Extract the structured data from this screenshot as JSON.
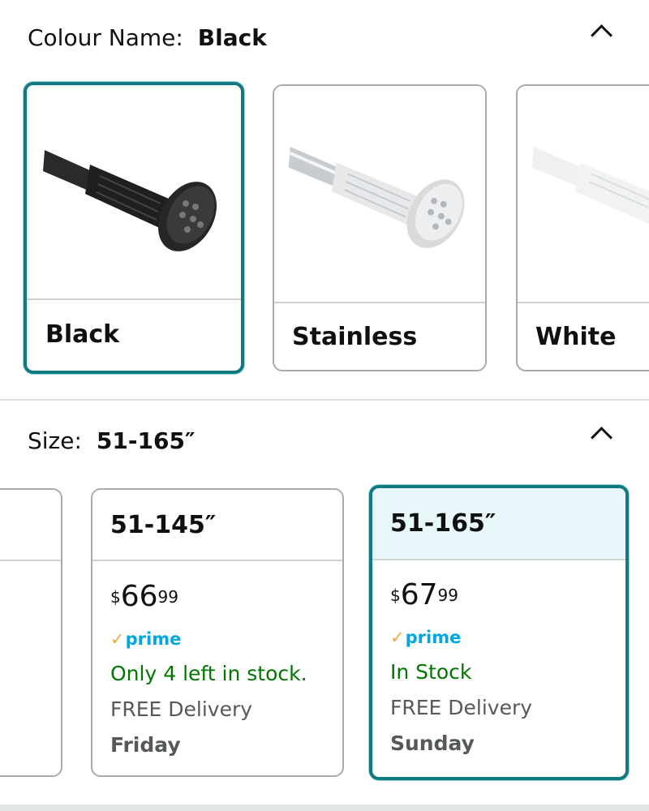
{
  "colour_section": {
    "label": "Colour Name:",
    "selected_value": "Black",
    "collapse_icon": "chevron-up-icon",
    "options": [
      {
        "label": "Black",
        "selected": true
      },
      {
        "label": "Stainless",
        "selected": false
      },
      {
        "label": "White",
        "selected": false
      }
    ]
  },
  "size_section": {
    "label": "Size:",
    "selected_value": "51-165″",
    "collapse_icon": "chevron-up-icon",
    "options": [
      {
        "size": "51-145″",
        "price_currency": "$",
        "price_whole": "66",
        "price_fraction": "99",
        "prime": "prime",
        "stock": "Only 4 left in stock.",
        "delivery": "FREE Delivery",
        "delivery_day": "Friday",
        "selected": false
      },
      {
        "size": "51-165″",
        "price_currency": "$",
        "price_whole": "67",
        "price_fraction": "99",
        "prime": "prime",
        "stock": "In Stock",
        "delivery": "FREE Delivery",
        "delivery_day": "Sunday",
        "selected": true
      }
    ]
  },
  "colors": {
    "selected_border": "#117981",
    "selected_header_bg": "#e8f8fa",
    "in_stock_green": "#007600",
    "prime_blue": "#00a8e1",
    "prime_check_orange": "#f3a847"
  }
}
